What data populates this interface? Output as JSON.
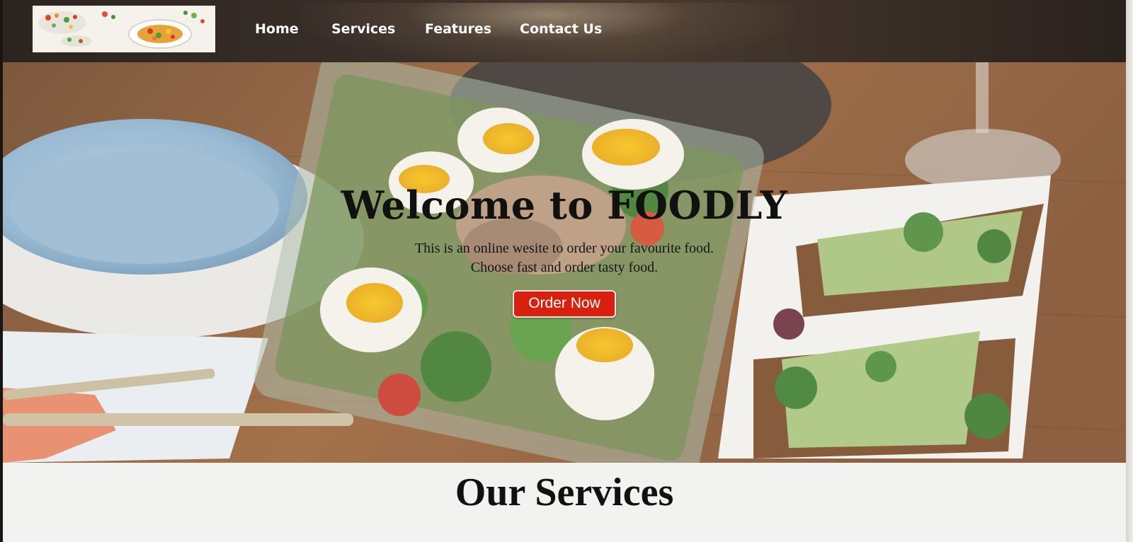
{
  "nav": {
    "logo_alt": "FOODLY logo",
    "links": [
      "Home",
      "Services",
      "Features",
      "Contact Us"
    ]
  },
  "hero": {
    "title": "Welcome to FOODLY",
    "subtitle_line1": "This is an online wesite to order your favourite food.",
    "subtitle_line2": "Choose fast and order tasty food.",
    "cta_label": "Order Now"
  },
  "services": {
    "title": "Our Services"
  },
  "colors": {
    "cta": "#d8200f",
    "nav_text": "#ffffff",
    "title_text": "#111111"
  }
}
